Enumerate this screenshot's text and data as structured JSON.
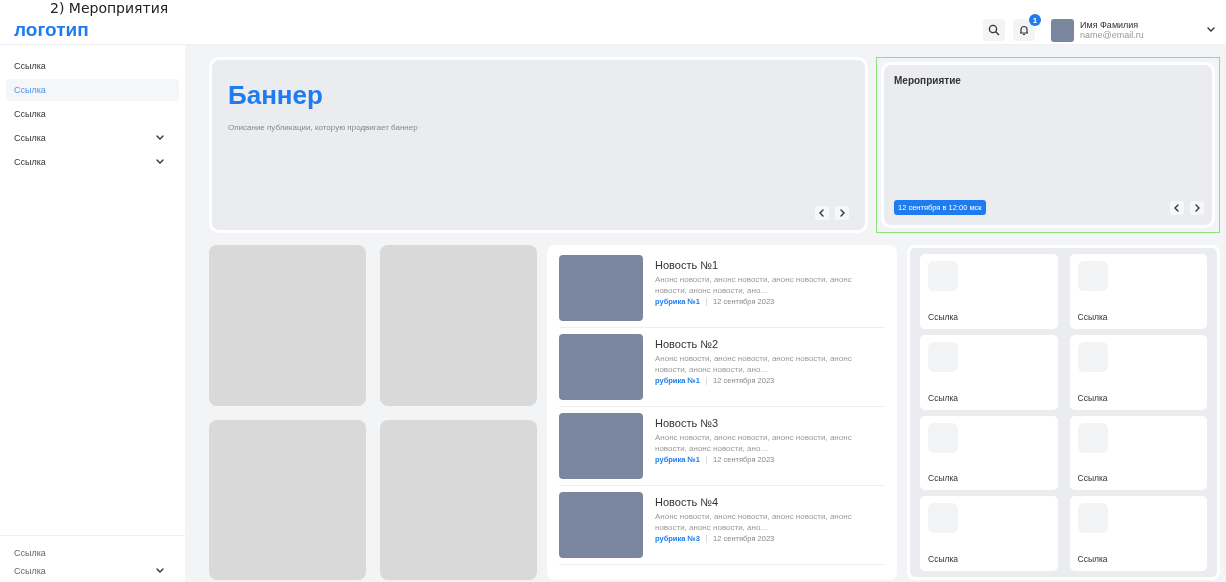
{
  "annotation": "2) Мероприятия",
  "header": {
    "logo": "логотип",
    "notifications": {
      "count": "1"
    },
    "user": {
      "name": "Имя Фамилия",
      "email": "name@email.ru"
    }
  },
  "sidebar": {
    "items": [
      {
        "label": "Ссылка",
        "selected": false,
        "expandable": false
      },
      {
        "label": "Ссылка",
        "selected": true,
        "expandable": false
      },
      {
        "label": "Ссылка",
        "selected": false,
        "expandable": false
      },
      {
        "label": "Ссылка",
        "selected": false,
        "expandable": true
      },
      {
        "label": "Ссылка",
        "selected": false,
        "expandable": true
      }
    ],
    "footer_items": [
      {
        "label": "Ссылка",
        "selected": false,
        "expandable": false
      },
      {
        "label": "Ссылка",
        "selected": false,
        "expandable": true
      }
    ]
  },
  "banner": {
    "title": "Баннер",
    "description": "Описание публикации, которую продвигает баннер"
  },
  "event": {
    "title": "Мероприятие",
    "date": "12 сентября в 12:00 мск",
    "highlighted": true
  },
  "tiles": [
    {
      "kind": "placeholder"
    },
    {
      "kind": "placeholder"
    },
    {
      "kind": "placeholder"
    },
    {
      "kind": "placeholder"
    }
  ],
  "news": [
    {
      "title": "Новость №1",
      "text": "Анонс новости, анонс новости, анонс новости, анонс новости, анонс новости, ано…",
      "rubric": "рубрика №1",
      "date": "12 сентября 2023"
    },
    {
      "title": "Новость №2",
      "text": "Анонс новости, анонс новости, анонс новости, анонс новости, анонс новости, ано…",
      "rubric": "рубрика №1",
      "date": "12 сентября 2023"
    },
    {
      "title": "Новость №3",
      "text": "Анонс новости, анонс новости, анонс новости, анонс новости, анонс новости, ано…",
      "rubric": "рубрика №1",
      "date": "12 сентября 2023"
    },
    {
      "title": "Новость №4",
      "text": "Анонс новости, анонс новости, анонс новости, анонс новости, анонс новости, ано…",
      "rubric": "рубрика №3",
      "date": "12 сентября 2023"
    }
  ],
  "links": [
    {
      "label": "Ссылка"
    },
    {
      "label": "Ссылка"
    },
    {
      "label": "Ссылка"
    },
    {
      "label": "Ссылка"
    },
    {
      "label": "Ссылка"
    },
    {
      "label": "Ссылка"
    },
    {
      "label": "Ссылка"
    },
    {
      "label": "Ссылка"
    }
  ]
}
